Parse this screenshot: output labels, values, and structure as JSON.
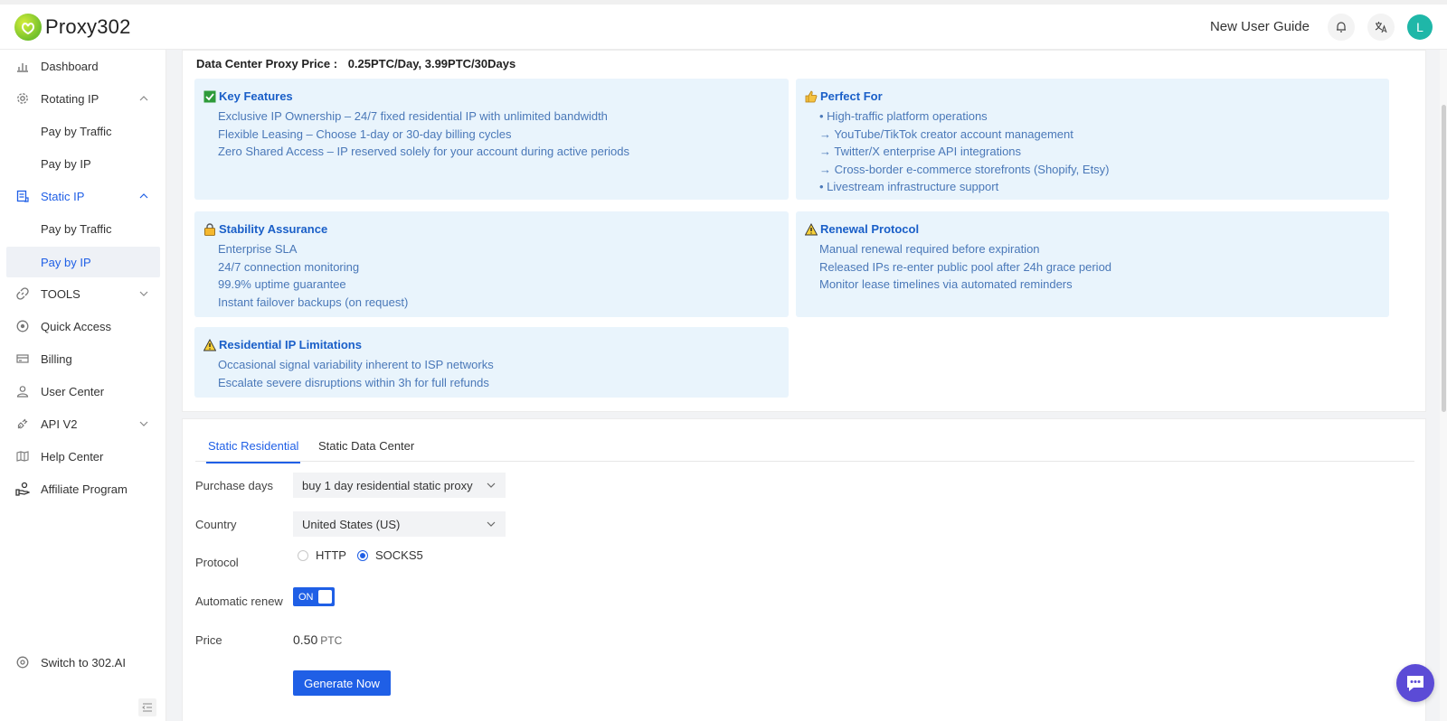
{
  "header": {
    "brand": "Proxy302",
    "guide_label": "New User Guide",
    "avatar_letter": "L"
  },
  "sidebar": {
    "dashboard": "Dashboard",
    "rotating_ip": "Rotating IP",
    "rotating_pay_traffic": "Pay by Traffic",
    "rotating_pay_ip": "Pay by IP",
    "static_ip": "Static IP",
    "static_pay_traffic": "Pay by Traffic",
    "static_pay_ip": "Pay by IP",
    "tools": "TOOLS",
    "quick_access": "Quick Access",
    "billing": "Billing",
    "user_center": "User Center",
    "api_v2": "API V2",
    "help_center": "Help Center",
    "affiliate": "Affiliate Program",
    "switch": "Switch to 302.AI"
  },
  "info": {
    "price_label": "Data Center Proxy Price :",
    "price_value": "0.25PTC/Day, 3.99PTC/30Days",
    "key_features": {
      "title": "Key Features",
      "lines": [
        "Exclusive IP Ownership – 24/7 fixed residential IP with unlimited bandwidth",
        "Flexible Leasing – Choose 1-day or 30-day billing cycles",
        "Zero Shared Access – IP reserved solely for your account during active periods"
      ]
    },
    "perfect_for": {
      "title": "Perfect For",
      "lines": [
        "• High-traffic platform operations",
        "→ YouTube/TikTok creator account management",
        "→ Twitter/X enterprise API integrations",
        "→ Cross-border e-commerce storefronts (Shopify, Etsy)",
        "• Livestream infrastructure support"
      ]
    },
    "stability": {
      "title": "Stability Assurance",
      "lines": [
        "Enterprise SLA",
        "24/7 connection monitoring",
        "99.9% uptime guarantee",
        "Instant failover backups (on request)"
      ]
    },
    "renewal": {
      "title": "Renewal Protocol",
      "lines": [
        "Manual renewal required before expiration",
        "Released IPs re-enter public pool after 24h grace period",
        "Monitor lease timelines via automated reminders"
      ]
    },
    "limitations": {
      "title": "Residential IP Limitations",
      "lines": [
        "Occasional signal variability inherent to ISP networks",
        "Escalate severe disruptions within 3h for full refunds"
      ]
    }
  },
  "form": {
    "tab_residential": "Static Residential",
    "tab_datacenter": "Static Data Center",
    "purchase_days_label": "Purchase days",
    "purchase_days_value": "buy 1 day residential static proxy",
    "country_label": "Country",
    "country_value": "United States (US)",
    "protocol_label": "Protocol",
    "protocol_http": "HTTP",
    "protocol_socks5": "SOCKS5",
    "protocol_selected": "SOCKS5",
    "renew_label": "Automatic renew",
    "renew_state": "ON",
    "price_label": "Price",
    "price_value": "0.50",
    "price_unit": "PTC",
    "generate_label": "Generate Now"
  },
  "colors": {
    "accent": "#1f5fe6",
    "panel_bg": "#e9f4fc",
    "panel_text": "#4a78b8",
    "avatar": "#1fb7a8",
    "chat": "#5b4bd6"
  }
}
